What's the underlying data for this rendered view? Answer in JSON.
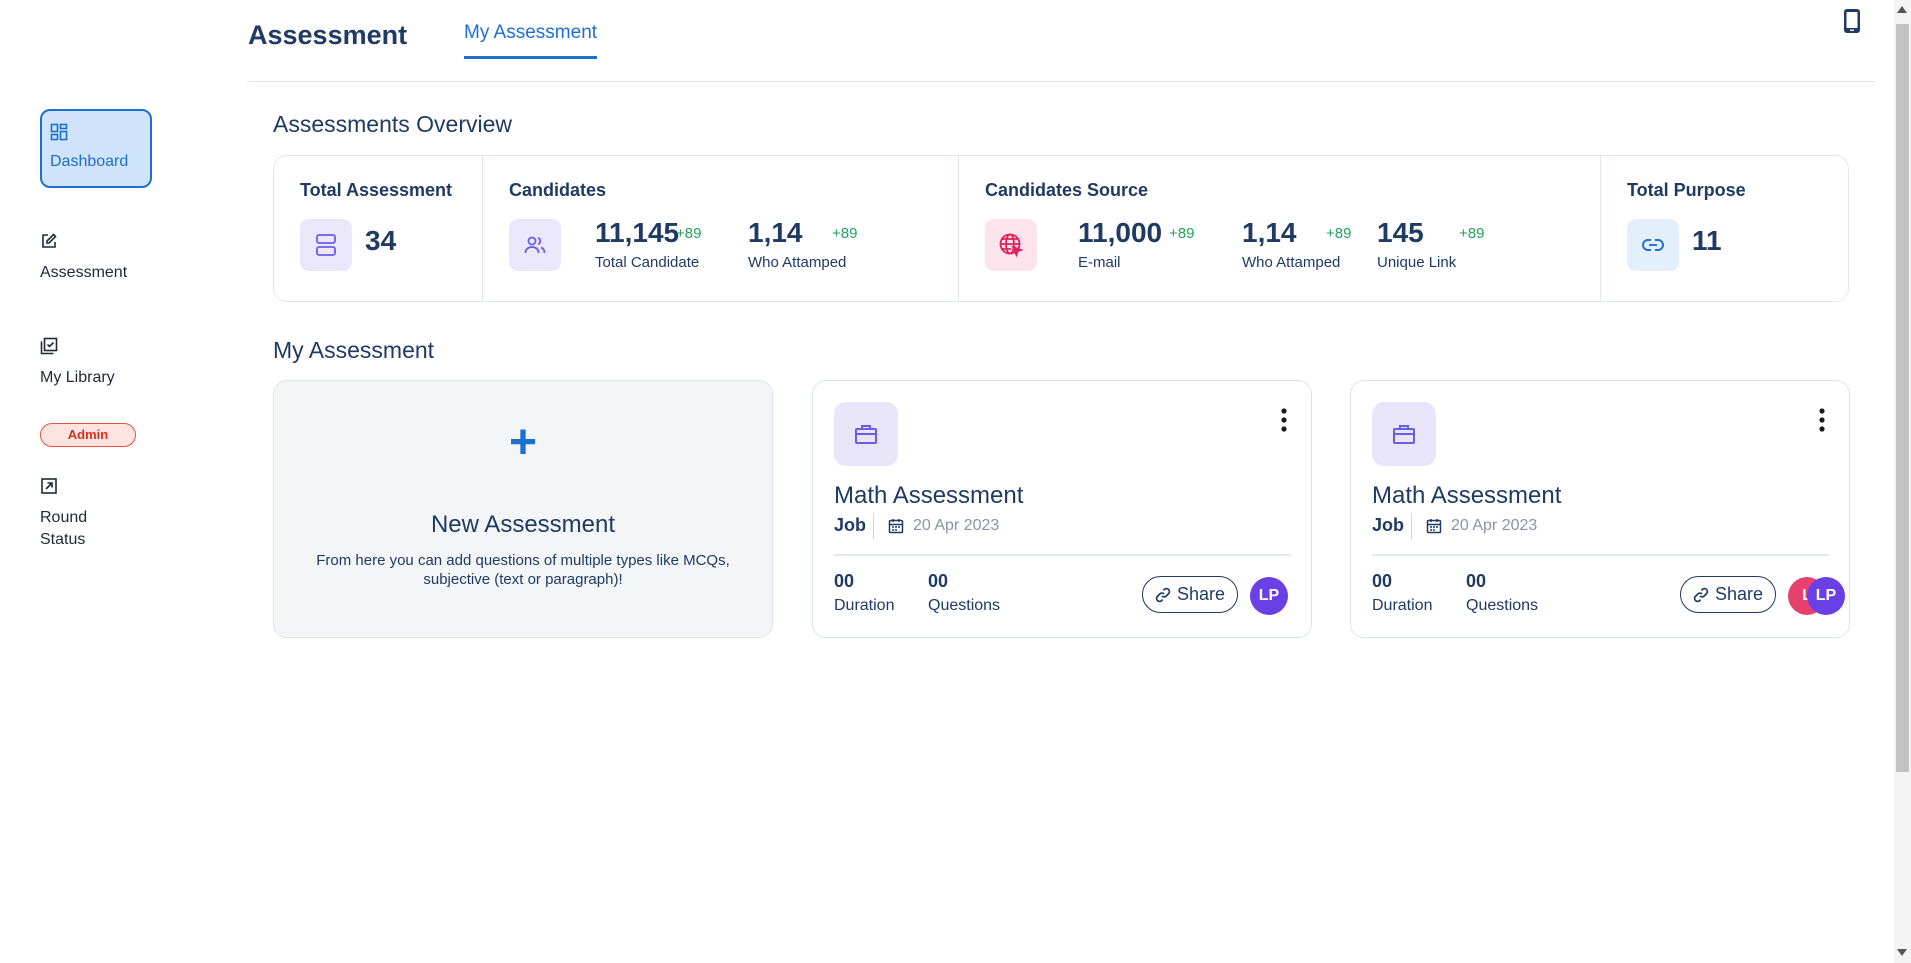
{
  "sidebar": {
    "items": [
      {
        "label": "Dashboard",
        "icon": "dashboard-icon"
      },
      {
        "label": "Assessment",
        "icon": "edit-icon"
      },
      {
        "label": "My Library",
        "icon": "library-check-icon"
      },
      {
        "label": "Round Status",
        "icon": "external-link-icon"
      }
    ],
    "admin_badge": "Admin"
  },
  "header": {
    "title": "Assessment",
    "tab_active": "My Assessment",
    "device_icon": "phone-icon"
  },
  "overview": {
    "title": "Assessments Overview",
    "total_assessment": {
      "label": "Total Assessment",
      "value": "34",
      "icon": "server-icon"
    },
    "candidates": {
      "label": "Candidates",
      "icon": "users-icon",
      "total_value": "11,145",
      "total_delta": "+89",
      "total_label": "Total Candidate",
      "attempted_value": "1,14",
      "attempted_delta": "+89",
      "attempted_label": "Who Attamped"
    },
    "source": {
      "label": "Candidates Source",
      "icon": "globe-cursor-icon",
      "email_value": "11,000",
      "email_delta": "+89",
      "email_label": "E-mail",
      "attempted_value": "1,14",
      "attempted_delta": "+89",
      "attempted_label": "Who Attamped",
      "link_value": "145",
      "link_delta": "+89",
      "link_label": "Unique Link"
    },
    "purpose": {
      "label": "Total Purpose",
      "value": "11",
      "icon": "link-icon"
    }
  },
  "my_assessment": {
    "title": "My Assessment",
    "new_card": {
      "plus": "+",
      "title": "New Assessment",
      "description": "From here you can add questions of multiple types like MCQs, subjective (text or paragraph)!"
    },
    "cards": [
      {
        "title": "Math Assessment",
        "type": "Job",
        "date": "20 Apr 2023",
        "duration_value": "00",
        "duration_label": "Duration",
        "questions_value": "00",
        "questions_label": "Questions",
        "share_label": "Share",
        "avatars": [
          "LP"
        ]
      },
      {
        "title": "Math Assessment",
        "type": "Job",
        "date": "20 Apr 2023",
        "duration_value": "00",
        "duration_label": "Duration",
        "questions_value": "00",
        "questions_label": "Questions",
        "share_label": "Share",
        "avatars": [
          "L",
          "LP"
        ]
      }
    ]
  },
  "colors": {
    "accent": "#1d6fd1",
    "text": "#1f3a63",
    "positive": "#22a35a",
    "avatar_purple": "#6b3fe6",
    "avatar_pink": "#e8406e"
  }
}
